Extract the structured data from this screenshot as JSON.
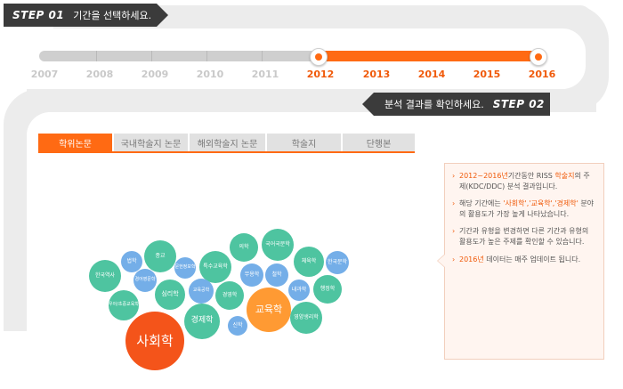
{
  "step1": {
    "label": "STEP 01",
    "text": "기간을 선택하세요."
  },
  "step2": {
    "label": "STEP 02",
    "text": "분석 결과를 확인하세요."
  },
  "years": [
    "2007",
    "2008",
    "2009",
    "2010",
    "2011",
    "2012",
    "2013",
    "2014",
    "2015",
    "2016"
  ],
  "selected_range": {
    "start": "2012",
    "end": "2016"
  },
  "tabs": [
    {
      "label": "학위논문",
      "active": true
    },
    {
      "label": "국내학술지 논문",
      "active": false
    },
    {
      "label": "해외학술지 논문",
      "active": false
    },
    {
      "label": "학술지",
      "active": false
    },
    {
      "label": "단행본",
      "active": false
    }
  ],
  "bubbles": [
    "사회학",
    "교육학",
    "경제학",
    "심리학",
    "국어국문학",
    "체육학",
    "경영학",
    "특수교육학",
    "의학",
    "철학",
    "신학",
    "법학",
    "종교",
    "한국역사",
    "행정학",
    "내과학",
    "영양생리학",
    "한국문학",
    "무용학",
    "문헌정보학",
    "경어영문학",
    "우아/초중교육학",
    "교육공학"
  ],
  "info": {
    "item1": {
      "pre": "",
      "hl1": "2012~2016년",
      "mid": "기간동안 RISS ",
      "hl2": "학술지",
      "post": "의 주제(KDC/DDC) 분석 결과입니다."
    },
    "item2": {
      "pre": "해당 기간에는 ",
      "hl": "'사회학','교육학','경제학'",
      "post": " 분야의 활용도가 가장 높게 나타났습니다."
    },
    "item3": {
      "text": "기간과 유형을 변경하면 다른 기간과 유형의 활용도가 높은 주제를 확인할 수 있습니다."
    },
    "item4": {
      "hl": "2016년",
      "post": " 데이터는 매주 업데이트 됩니다."
    }
  },
  "colors": {
    "accent": "#ff6a13",
    "banner": "#3b3b3b",
    "bubble_green": "#4ec4a0",
    "bubble_blue": "#74aee8",
    "bubble_orange": "#ff9a33",
    "bubble_red": "#f4541a"
  }
}
